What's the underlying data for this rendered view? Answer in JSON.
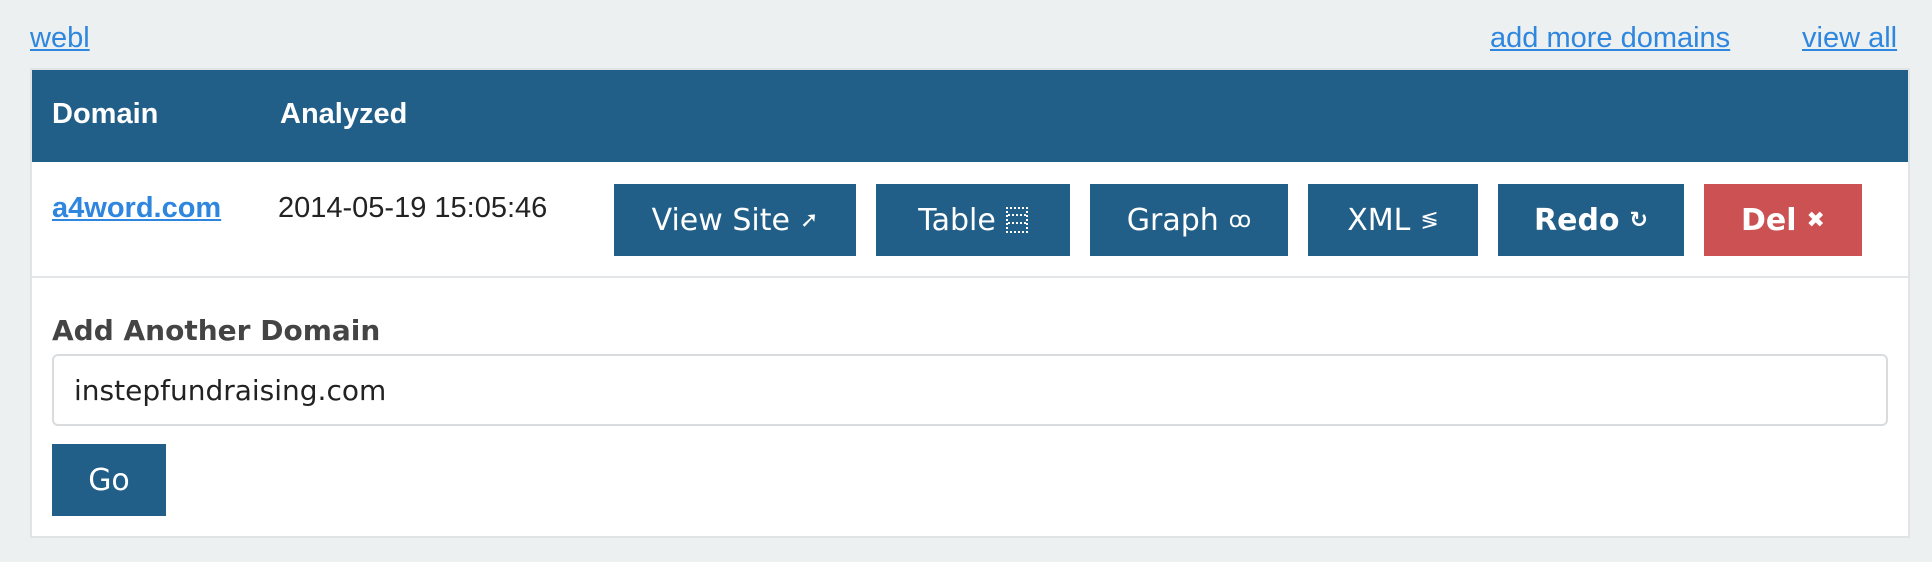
{
  "top_links": {
    "home": "webl",
    "add_more": "add more domains",
    "view_all": "view all"
  },
  "table": {
    "headers": {
      "domain": "Domain",
      "analyzed": "Analyzed"
    },
    "rows": [
      {
        "domain": "a4word.com",
        "analyzed": "2014-05-19 15:05:46",
        "actions": [
          {
            "label": "View Site",
            "icon": "external-arrow-icon",
            "glyph": "➚"
          },
          {
            "label": "Table",
            "icon": "table-icon",
            "glyph": ""
          },
          {
            "label": "Graph",
            "icon": "graph-icon",
            "glyph": "ꝏ"
          },
          {
            "label": "XML",
            "icon": "xml-icon",
            "glyph": "≶"
          },
          {
            "label": "Redo",
            "icon": "redo-icon",
            "glyph": "↻"
          },
          {
            "label": "Del",
            "icon": "close-icon",
            "glyph": "✖"
          }
        ]
      }
    ]
  },
  "form": {
    "label": "Add Another Domain",
    "input_value": "instepfundraising.com",
    "submit_label": "Go"
  },
  "colors": {
    "primary": "#225f88",
    "danger": "#cb5153",
    "link": "#2e86de",
    "background": "#ecf0f1"
  }
}
